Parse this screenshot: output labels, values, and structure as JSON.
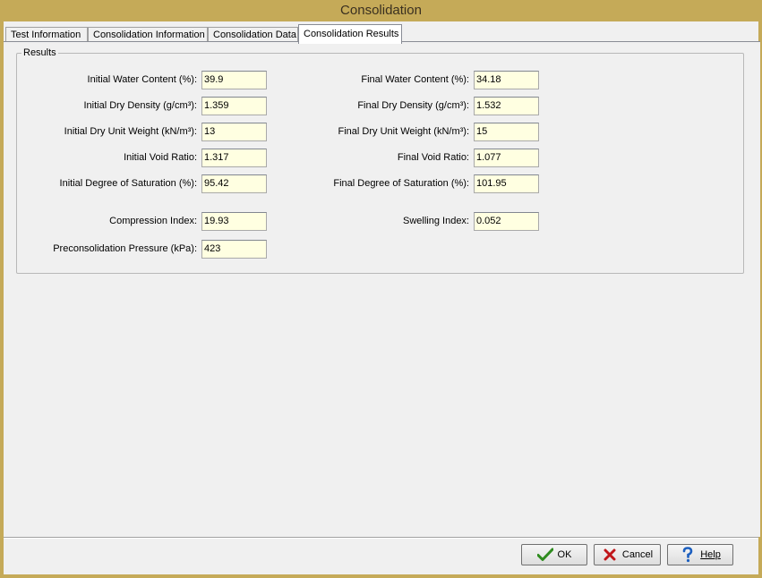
{
  "window": {
    "title": "Consolidation"
  },
  "tabs": [
    {
      "label": "Test Information"
    },
    {
      "label": "Consolidation Information"
    },
    {
      "label": "Consolidation Data"
    },
    {
      "label": "Consolidation Results"
    }
  ],
  "results": {
    "group_title": "Results",
    "left": [
      {
        "label": "Initial Water Content (%):",
        "value": "39.9"
      },
      {
        "label": "Initial Dry Density (g/cm³):",
        "value": "1.359"
      },
      {
        "label": "Initial Dry Unit Weight (kN/m³):",
        "value": "13"
      },
      {
        "label": "Initial Void Ratio:",
        "value": "1.317"
      },
      {
        "label": "Initial Degree of Saturation (%):",
        "value": "95.42"
      },
      {
        "label": "Compression Index:",
        "value": "19.93"
      },
      {
        "label": "Preconsolidation Pressure (kPa):",
        "value": "423"
      }
    ],
    "right": [
      {
        "label": "Final Water Content (%):",
        "value": "34.18"
      },
      {
        "label": "Final Dry Density (g/cm³):",
        "value": "1.532"
      },
      {
        "label": "Final Dry Unit Weight (kN/m³):",
        "value": "15"
      },
      {
        "label": "Final Void Ratio:",
        "value": "1.077"
      },
      {
        "label": "Final Degree of Saturation (%):",
        "value": "101.95"
      },
      {
        "label": "Swelling Index:",
        "value": "0.052"
      }
    ]
  },
  "buttons": {
    "ok": {
      "label": "OK",
      "icon": "check-icon"
    },
    "cancel": {
      "label": "Cancel",
      "icon": "x-icon"
    },
    "help": {
      "label": "Help",
      "icon": "question-icon"
    }
  },
  "colors": {
    "title_bar": "#c5aa58",
    "field_background": "#ffffe1",
    "ok_check": "#2e8b1e",
    "cancel_x": "#c0161a",
    "help_question": "#1c5fbf"
  }
}
